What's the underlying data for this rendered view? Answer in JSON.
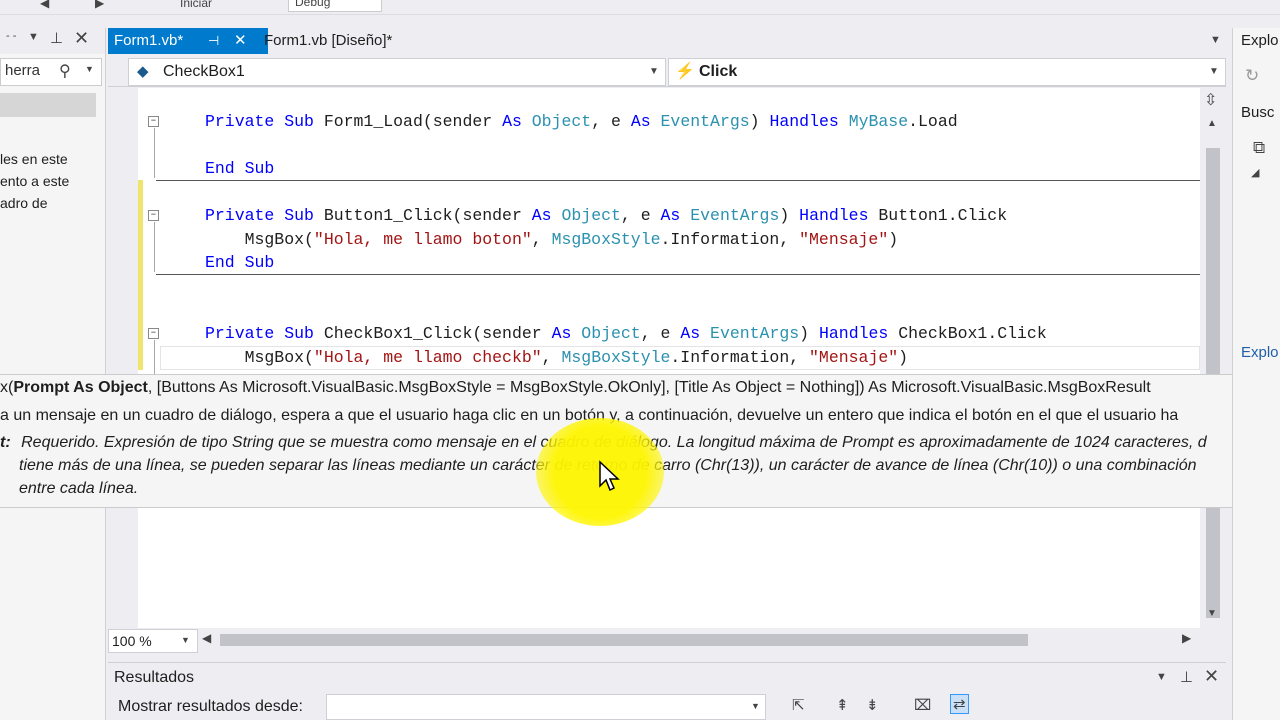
{
  "toolbar": {
    "start_label": "Iniciar",
    "config_value": "Debug"
  },
  "left_panel": {
    "search_text": "herra",
    "description_lines": [
      "les en este",
      "ento a este",
      "adro de"
    ]
  },
  "tabs": [
    {
      "label": "Form1.vb*",
      "pin": "⊣",
      "close": "✕"
    },
    {
      "label": "Form1.vb [Diseño]*"
    }
  ],
  "nav": {
    "object_combo": "CheckBox1",
    "event_combo": "Click"
  },
  "code": {
    "lines": [
      {
        "parts": [
          [
            "kw",
            "Private "
          ],
          [
            "kw",
            "Sub "
          ],
          [
            "",
            "Form1_Load(sender "
          ],
          [
            "kw",
            "As "
          ],
          [
            "ty",
            "Object"
          ],
          [
            "",
            ", e "
          ],
          [
            "kw",
            "As "
          ],
          [
            "ty",
            "EventArgs"
          ],
          [
            "",
            ") "
          ],
          [
            "kw",
            "Handles "
          ],
          [
            "ty",
            "MyBase"
          ],
          [
            "",
            ".Load"
          ]
        ]
      },
      {
        "parts": [
          [
            "kw",
            "End "
          ],
          [
            "kw",
            "Sub"
          ]
        ]
      },
      {
        "parts": [
          [
            "kw",
            "Private "
          ],
          [
            "kw",
            "Sub "
          ],
          [
            "",
            "Button1_Click(sender "
          ],
          [
            "kw",
            "As "
          ],
          [
            "ty",
            "Object"
          ],
          [
            "",
            ", e "
          ],
          [
            "kw",
            "As "
          ],
          [
            "ty",
            "EventArgs"
          ],
          [
            "",
            ") "
          ],
          [
            "kw",
            "Handles "
          ],
          [
            "",
            "Button1.Click"
          ]
        ]
      },
      {
        "parts": [
          [
            "",
            "    MsgBox("
          ],
          [
            "st",
            "\"Hola, me llamo boton\""
          ],
          [
            "",
            ", "
          ],
          [
            "ty",
            "MsgBoxStyle"
          ],
          [
            "",
            ".Information, "
          ],
          [
            "st",
            "\"Mensaje\""
          ],
          [
            "",
            ")"
          ]
        ]
      },
      {
        "parts": [
          [
            "kw",
            "End "
          ],
          [
            "kw",
            "Sub"
          ]
        ]
      },
      {
        "parts": [
          [
            "kw",
            "Private "
          ],
          [
            "kw",
            "Sub "
          ],
          [
            "",
            "CheckBox1_Click(sender "
          ],
          [
            "kw",
            "As "
          ],
          [
            "ty",
            "Object"
          ],
          [
            "",
            ", e "
          ],
          [
            "kw",
            "As "
          ],
          [
            "ty",
            "EventArgs"
          ],
          [
            "",
            ") "
          ],
          [
            "kw",
            "Handles "
          ],
          [
            "",
            "CheckBox1.Click"
          ]
        ]
      },
      {
        "parts": [
          [
            "",
            "    MsgBox("
          ],
          [
            "st",
            "\"Hola, me llamo checkb\""
          ],
          [
            "",
            ", "
          ],
          [
            "ty",
            "MsgBoxStyle"
          ],
          [
            "",
            ".Information, "
          ],
          [
            "st",
            "\"Mensaje\""
          ],
          [
            "",
            ")"
          ]
        ]
      }
    ]
  },
  "tooltip": {
    "sig_prefix": "x(",
    "sig_param": "Prompt As Object",
    "sig_rest": ", [Buttons As Microsoft.VisualBasic.MsgBoxStyle = MsgBoxStyle.OkOnly], [Title As Object = Nothing]) As Microsoft.VisualBasic.MsgBoxResult",
    "description": "a un mensaje en un cuadro de diálogo, espera a que el usuario haga clic en un botón y, a continuación, devuelve un entero que indica el botón en el que el usuario ha",
    "param_label": "t:",
    "param_line1": "Requerido. Expresión de tipo String que se muestra como mensaje en el cuadro de diálogo. La longitud máxima de Prompt es aproximadamente de 1024 caracteres, d",
    "param_line2": "tiene más de una línea, se pueden separar las líneas mediante un carácter de retorno de carro (Chr(13)), un carácter de avance de línea (Chr(10)) o una combinación",
    "param_line3": "entre cada línea."
  },
  "editor_status": {
    "zoom": "100 %"
  },
  "results": {
    "title": "Resultados",
    "show_from_label": "Mostrar resultados desde:"
  },
  "right_panel": {
    "title_top": "Explo",
    "search": "Busc",
    "title_bottom": "Explo"
  }
}
